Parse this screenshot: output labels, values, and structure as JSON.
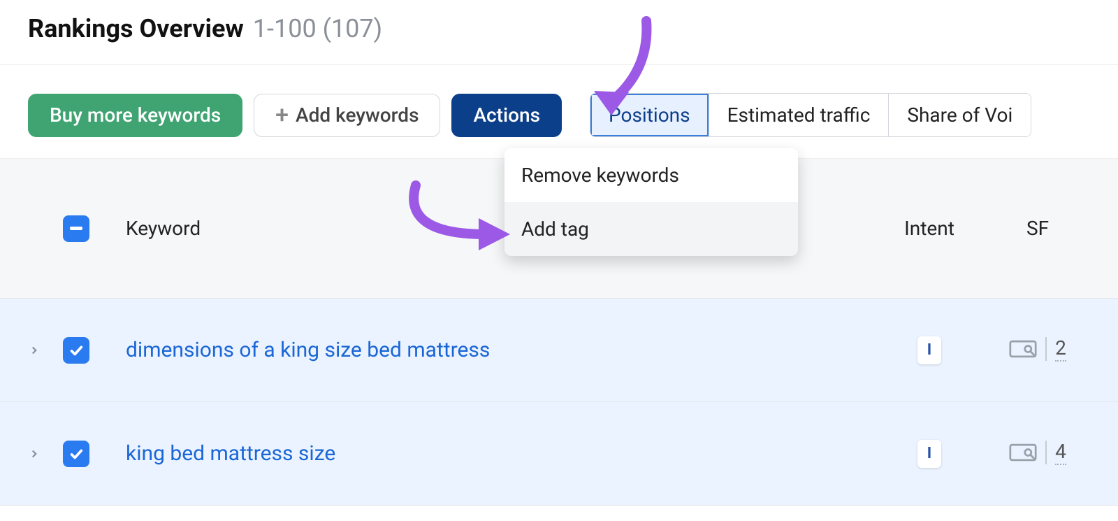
{
  "header": {
    "title": "Rankings Overview",
    "range": "1-100 (107)"
  },
  "toolbar": {
    "buy_more": "Buy more keywords",
    "add_keywords": "Add keywords",
    "actions": "Actions"
  },
  "tabs": {
    "positions": "Positions",
    "estimated_traffic": "Estimated traffic",
    "share_of_voice": "Share of Voi"
  },
  "actions_menu": {
    "remove": "Remove keywords",
    "add_tag": "Add tag"
  },
  "table": {
    "columns": {
      "keyword": "Keyword",
      "intent": "Intent",
      "sf": "SF"
    },
    "rows": [
      {
        "keyword": "dimensions of a king size bed mattress",
        "intent": "I",
        "sf": "2"
      },
      {
        "keyword": "king bed mattress size",
        "intent": "I",
        "sf": "4"
      }
    ]
  }
}
